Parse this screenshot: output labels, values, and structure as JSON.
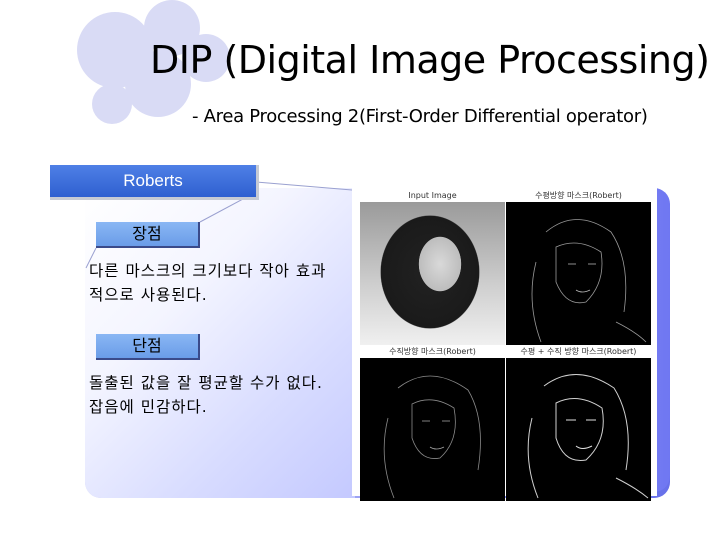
{
  "slide": {
    "title": "DIP (Digital Image Processing)",
    "subtitle": "- Area Processing 2(First-Order Differential operator)",
    "accent_color": "#2e5fd0",
    "decor_circle_color": "#d9dbf5"
  },
  "section": {
    "tab_label": "Roberts",
    "pros_label": "장점",
    "pros_text": "다른 마스크의 크기보다 작아 효과적으로 사용된다.",
    "cons_label": "단점",
    "cons_text": "돌출된 값을 잘 평균할 수가 없다. 잡음에 민감하다."
  },
  "figure": {
    "captions": [
      "Input Image",
      "수평방향 마스크(Robert)",
      "수직방향 마스크(Robert)",
      "수평 + 수직 방향 마스크(Robert)"
    ]
  }
}
